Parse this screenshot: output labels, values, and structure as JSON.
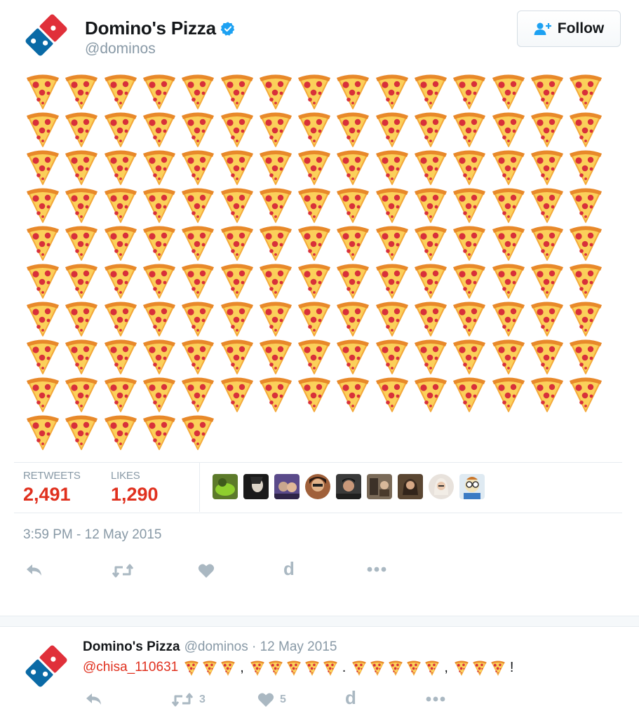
{
  "tweet": {
    "author": {
      "name": "Domino's Pizza",
      "handle": "@dominos",
      "verified_icon": "verified-badge-icon"
    },
    "follow_button": {
      "label": "Follow",
      "icon": "add-user-icon"
    },
    "body": {
      "emoji": "pizza-slice-emoji",
      "count": 140,
      "per_row": 15
    },
    "stats": {
      "retweets_label": "RETWEETS",
      "retweets_value": "2,491",
      "likes_label": "LIKES",
      "likes_value": "1,290"
    },
    "liked_by_avatars": [
      "avatar-1",
      "avatar-2",
      "avatar-3",
      "avatar-4",
      "avatar-5",
      "avatar-6",
      "avatar-7",
      "avatar-8",
      "avatar-9"
    ],
    "timestamp": "3:59 PM - 12 May 2015",
    "actions": [
      "reply-icon",
      "retweet-icon",
      "like-icon",
      "d",
      "more-icon"
    ]
  },
  "reply": {
    "author_name": "Domino's Pizza",
    "meta": "@dominos · 12 May 2015",
    "mention": "@chisa_110631",
    "groups": [
      3,
      5,
      5,
      3
    ],
    "separators": [
      ",",
      ".",
      ",",
      "!"
    ],
    "retweet_count": "3",
    "like_count": "5",
    "d_label": "d"
  },
  "colors": {
    "brand_red": "#e0301e",
    "muted": "#8899a6",
    "icon_gray": "#aab8c2",
    "verified_blue": "#1da1f2"
  }
}
